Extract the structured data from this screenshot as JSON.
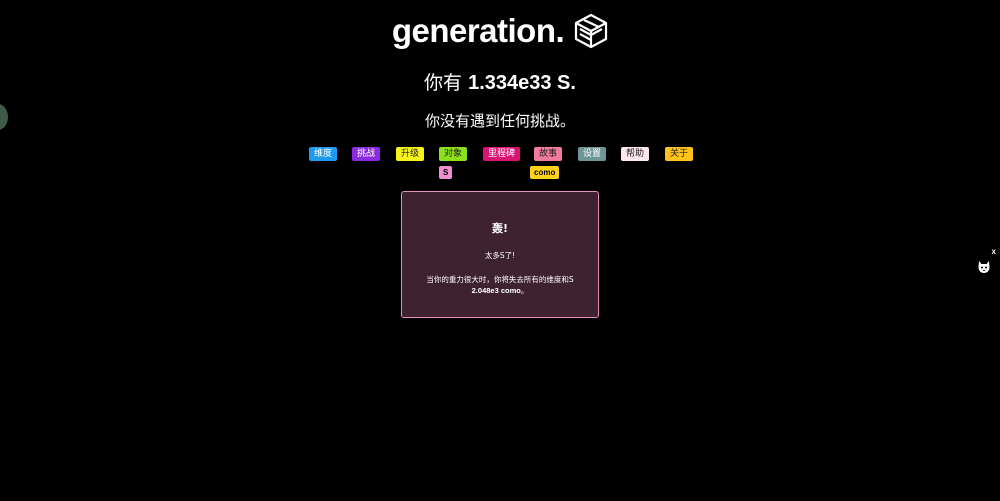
{
  "header": {
    "logo_text": "generation.",
    "logo_icon": "cube-icon",
    "amount_prefix": "你有 ",
    "amount_value": "1.334e33 S.",
    "challenge_status": "你没有遇到任何挑战。"
  },
  "tabs": [
    {
      "label": "维度",
      "color": "#1e9bf0",
      "text_color": "#ffffff"
    },
    {
      "label": "挑战",
      "color": "#8a2be2",
      "text_color": "#ffffff"
    },
    {
      "label": "升级",
      "color": "#f5f31a",
      "text_color": "#222222"
    },
    {
      "label": "对象",
      "color": "#8be21a",
      "text_color": "#222222"
    },
    {
      "label": "里程碑",
      "color": "#d91472",
      "text_color": "#ffffff"
    },
    {
      "label": "故事",
      "color": "#f07a9d",
      "text_color": "#222222"
    },
    {
      "label": "设置",
      "color": "#6f9596",
      "text_color": "#ffffff"
    },
    {
      "label": "帮助",
      "color": "#fde6ef",
      "text_color": "#222222"
    },
    {
      "label": "关于",
      "color": "#ffc21a",
      "text_color": "#222222"
    }
  ],
  "badges": {
    "s_badge": {
      "label": "S",
      "color": "#ee8fd0"
    },
    "como_badge": {
      "label": "como",
      "color": "#ffd21a"
    }
  },
  "modal": {
    "title": "轰!",
    "line1": "太多S了!",
    "line2_text": "当你的重力很大时，你将失去所有的维度和S",
    "line2_bold": "2.048e3 como",
    "line2_end": "。",
    "border_color": "#e48fbd",
    "background": "#3f2230"
  },
  "side_widget": {
    "close_label": "x",
    "icon": "cat-icon"
  }
}
